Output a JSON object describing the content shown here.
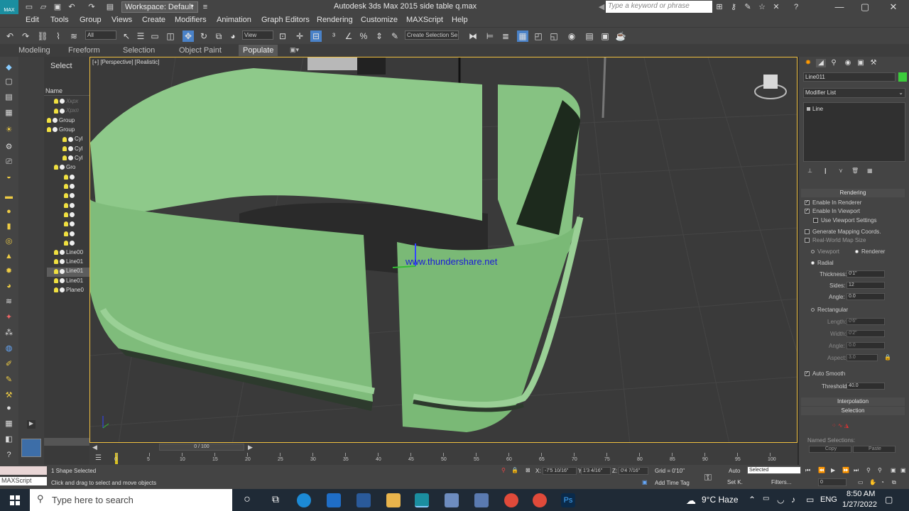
{
  "window": {
    "title": "Autodesk 3ds Max  2015     side table q.max",
    "app_logo": "MAX",
    "workspace": "Workspace: Default",
    "search_placeholder": "Type a keyword or phrase",
    "controls": {
      "minimize": "—",
      "maximize": "▢",
      "close": "✕"
    }
  },
  "menu": [
    "Edit",
    "Tools",
    "Group",
    "Views",
    "Create",
    "Modifiers",
    "Animation",
    "Graph Editors",
    "Rendering",
    "Customize",
    "MAXScript",
    "Help"
  ],
  "toolbar": {
    "selection_filter": "All",
    "ref_coord": "View",
    "named_selection": "Create Selection Se"
  },
  "ribbon": {
    "tabs": [
      "Modeling",
      "Freeform",
      "Selection",
      "Object Paint",
      "Populate"
    ],
    "active_index": 4
  },
  "explorer": {
    "title": "Select",
    "column_header": "Name",
    "rows": [
      {
        "label": "Хкрх",
        "type": "dim"
      },
      {
        "label": "Хрхп",
        "type": "dim"
      },
      {
        "label": "Group",
        "type": "group"
      },
      {
        "label": "Group",
        "type": "group"
      },
      {
        "label": "Cyl",
        "type": "obj"
      },
      {
        "label": "Cyl",
        "type": "obj"
      },
      {
        "label": "Cyl",
        "type": "obj"
      },
      {
        "label": "Gro",
        "type": "group"
      },
      {
        "label": "",
        "type": "obj"
      },
      {
        "label": "",
        "type": "obj"
      },
      {
        "label": "",
        "type": "obj"
      },
      {
        "label": "",
        "type": "obj"
      },
      {
        "label": "",
        "type": "obj"
      },
      {
        "label": "",
        "type": "obj"
      },
      {
        "label": "",
        "type": "obj"
      },
      {
        "label": "",
        "type": "obj"
      },
      {
        "label": "Line00",
        "type": "obj"
      },
      {
        "label": "Line01",
        "type": "obj"
      },
      {
        "label": "Line01",
        "type": "sel"
      },
      {
        "label": "Line01",
        "type": "obj"
      },
      {
        "label": "Plane0",
        "type": "obj"
      }
    ]
  },
  "viewport": {
    "label": "[+] [Perspective] [Realistic]",
    "watermark": "www.thundershare.net"
  },
  "command_panel": {
    "object_name": "Line011",
    "object_color": "#3ccc3c",
    "modifier_list": "Modifier List",
    "stack_item": "Line",
    "rendering": {
      "header": "Rendering",
      "enable_in_renderer": "Enable In Renderer",
      "enable_in_viewport": "Enable In Viewport",
      "use_viewport_settings": "Use Viewport Settings",
      "generate_mapping": "Generate Mapping Coords.",
      "real_world_map": "Real-World Map Size",
      "viewport_radio": "Viewport",
      "renderer_radio": "Renderer",
      "radial": "Radial",
      "thickness_label": "Thickness:",
      "thickness_value": "0'1\"",
      "sides_label": "Sides:",
      "sides_value": "12",
      "angle_label": "Angle:",
      "angle_value": "0.0",
      "rectangular": "Rectangular",
      "length_label": "Length:",
      "length_value": "0'6\"",
      "width_label": "Width:",
      "width_value": "0'2\"",
      "angle2_label": "Angle:",
      "angle2_value": "0.0",
      "aspect_label": "Aspect:",
      "aspect_value": "3.0",
      "auto_smooth": "Auto Smooth",
      "threshold_label": "Threshold:",
      "threshold_value": "40.0"
    },
    "interpolation_header": "Interpolation",
    "selection_header": "Selection",
    "named_selections": "Named Selections:",
    "copy_button": "Copy",
    "paste_button": "Paste"
  },
  "timeline": {
    "frame_display": "0 / 100",
    "ticks": [
      "0",
      "5",
      "10",
      "15",
      "20",
      "25",
      "30",
      "35",
      "40",
      "45",
      "50",
      "55",
      "60",
      "65",
      "70",
      "75",
      "80",
      "85",
      "90",
      "95",
      "100"
    ]
  },
  "status": {
    "maxscript_label": "MAXScript",
    "selection_count": "1 Shape Selected",
    "prompt": "Click and drag to select and move objects",
    "x_label": "X:",
    "x_value": "-7'5 10/16\"",
    "y_label": "Y:",
    "y_value": "1'3 4/16\"",
    "z_label": "Z:",
    "z_value": "0'4 7/16\"",
    "grid": "Grid = 0'10\"",
    "add_time_tag": "Add Time Tag",
    "auto_key": "Auto",
    "set_key": "Set K.",
    "key_filter": "Selected",
    "filters": "Filters...",
    "frame_field": "0"
  },
  "taskbar": {
    "search_placeholder": "Type here to search",
    "weather": "9°C  Haze",
    "language": "ENG",
    "time": "8:50 AM",
    "date": "1/27/2022"
  }
}
